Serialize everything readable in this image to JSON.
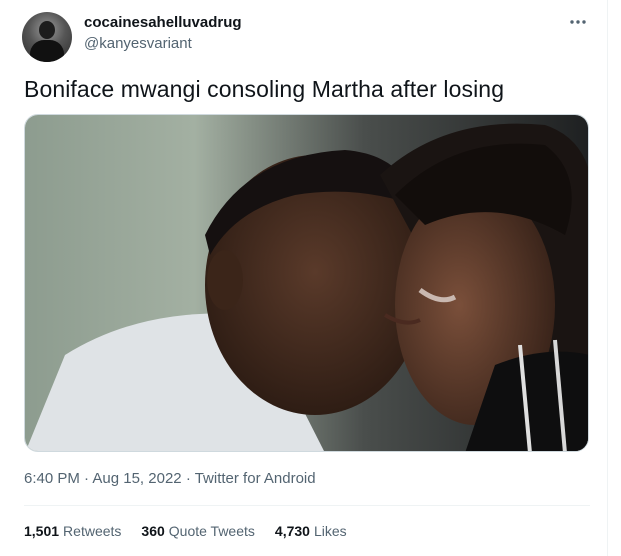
{
  "user": {
    "display_name": "cocainesahelluvadrug",
    "handle": "@kanyesvariant"
  },
  "icons": {
    "more": "more-horizontal-icon"
  },
  "tweet": {
    "text": "Boniface mwangi consoling Martha after losing",
    "time": "6:40 PM",
    "date": "Aug 15, 2022",
    "source": "Twitter for Android",
    "sep": "·"
  },
  "stats": [
    {
      "count": "1,501",
      "label": "Retweets"
    },
    {
      "count": "360",
      "label": "Quote Tweets"
    },
    {
      "count": "4,730",
      "label": "Likes"
    }
  ],
  "colors": {
    "text": "#0f1419",
    "secondary": "#536471",
    "border": "#cfd9de"
  }
}
